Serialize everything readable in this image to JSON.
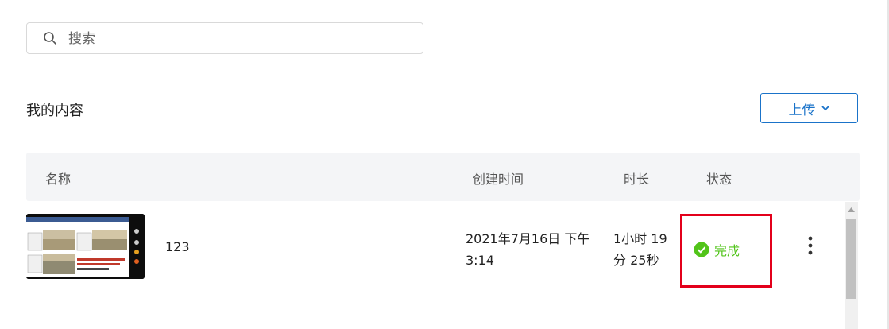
{
  "search": {
    "placeholder": "搜索",
    "value": ""
  },
  "section": {
    "title": "我的内容"
  },
  "upload": {
    "label": "上传"
  },
  "table": {
    "headers": {
      "name": "名称",
      "created": "创建时间",
      "duration": "时长",
      "status": "状态"
    },
    "rows": [
      {
        "name": "123",
        "created_line1": "2021年7月16日 下午",
        "created_line2": "3:14",
        "duration_line1": "1小时 19",
        "duration_line2": "分 25秒",
        "status": "完成"
      }
    ]
  },
  "colors": {
    "accent": "#1a73c9",
    "success": "#52c41a",
    "highlight": "#e3001b",
    "header_bg": "#f4f5f7"
  },
  "icons": {
    "search": "search-icon",
    "upload_chevron": "chevron-down-icon",
    "status": "check-circle-icon",
    "more": "more-vertical-icon"
  }
}
